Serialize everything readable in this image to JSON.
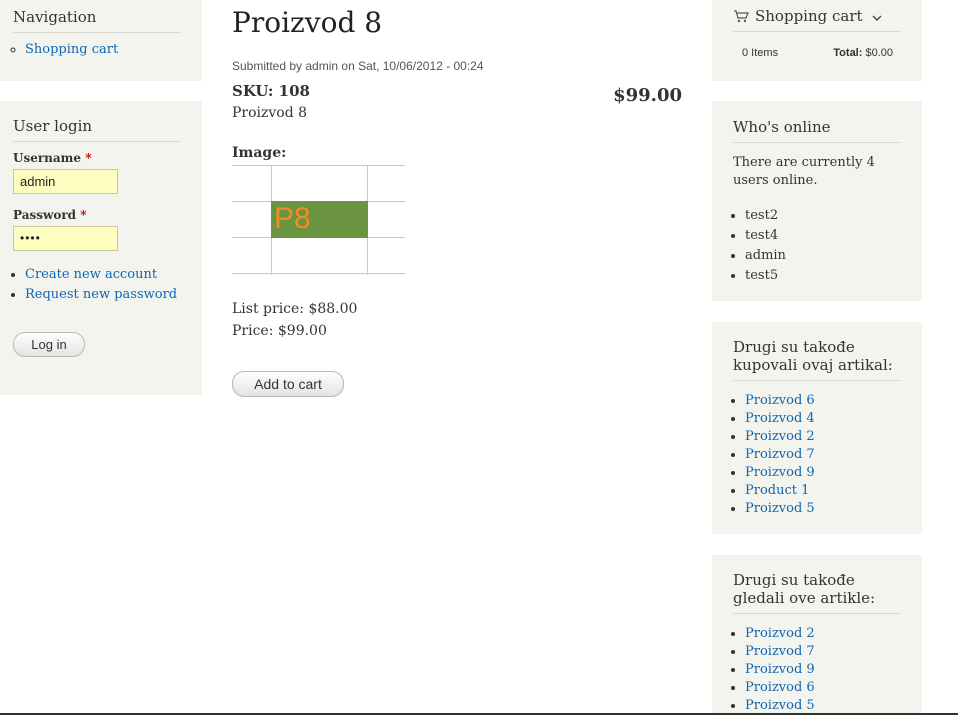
{
  "navigation": {
    "title": "Navigation",
    "items": [
      {
        "label": "Shopping cart"
      }
    ]
  },
  "user_login": {
    "title": "User login",
    "username_label": "Username",
    "username_value": "admin",
    "password_label": "Password",
    "password_value": "••••",
    "required_mark": "*",
    "links": [
      {
        "label": "Create new account"
      },
      {
        "label": "Request new password"
      }
    ],
    "login_button": "Log in"
  },
  "product": {
    "title": "Proizvod 8",
    "submitted": "Submitted by admin on Sat, 10/06/2012 - 00:24",
    "sku_label": "SKU: 108",
    "price_display": "$99.00",
    "name": "Proizvod 8",
    "image_label": "Image:",
    "image_text": "P8",
    "image_color": "#6b9440",
    "image_text_color": "#f08c28",
    "list_price": "List price: $88.00",
    "price": "Price: $99.00",
    "add_to_cart": "Add to cart"
  },
  "cart": {
    "title": "Shopping cart",
    "items": "0 Items",
    "total_label": "Total:",
    "total_value": "$0.00"
  },
  "whos_online": {
    "title": "Who's online",
    "text": "There are currently 4 users online.",
    "users": [
      "test2",
      "test4",
      "admin",
      "test5"
    ]
  },
  "bought": {
    "title": "Drugi su takođe kupovali ovaj artikal:",
    "items": [
      "Proizvod 6",
      "Proizvod 4",
      "Proizvod 2",
      "Proizvod 7",
      "Proizvod 9",
      "Product 1",
      "Proizvod 5"
    ]
  },
  "viewed": {
    "title": "Drugi su takođe gledali ove artikle:",
    "items": [
      "Proizvod 2",
      "Proizvod 7",
      "Proizvod 9",
      "Proizvod 6",
      "Proizvod 5"
    ]
  },
  "colors": {
    "link": "#0f66b0",
    "panel": "#f4f4ef"
  }
}
